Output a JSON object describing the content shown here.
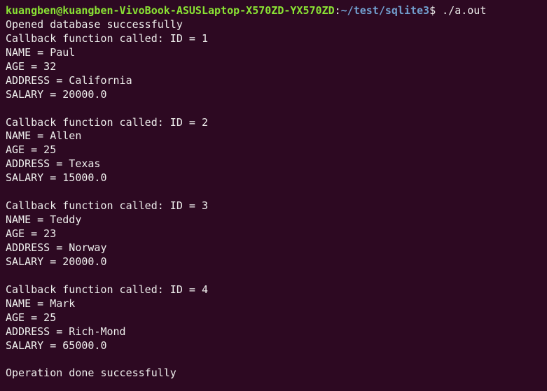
{
  "prompt": {
    "user_host": "kuangben@kuangben-VivoBook-ASUSLaptop-X570ZD-YX570ZD",
    "colon": ":",
    "path": "~/test/sqlite3",
    "dollar": "$",
    "command": " ./a.out"
  },
  "output": {
    "opened": "Opened database successfully",
    "records": [
      {
        "header": "Callback function called: ID = 1",
        "name": "NAME = Paul",
        "age": "AGE = 32",
        "address": "ADDRESS = California",
        "salary": "SALARY = 20000.0"
      },
      {
        "header": "Callback function called: ID = 2",
        "name": "NAME = Allen",
        "age": "AGE = 25",
        "address": "ADDRESS = Texas",
        "salary": "SALARY = 15000.0"
      },
      {
        "header": "Callback function called: ID = 3",
        "name": "NAME = Teddy",
        "age": "AGE = 23",
        "address": "ADDRESS = Norway",
        "salary": "SALARY = 20000.0"
      },
      {
        "header": "Callback function called: ID = 4",
        "name": "NAME = Mark",
        "age": "AGE = 25",
        "address": "ADDRESS = Rich-Mond",
        "salary": "SALARY = 65000.0"
      }
    ],
    "done": "Operation done successfully"
  }
}
